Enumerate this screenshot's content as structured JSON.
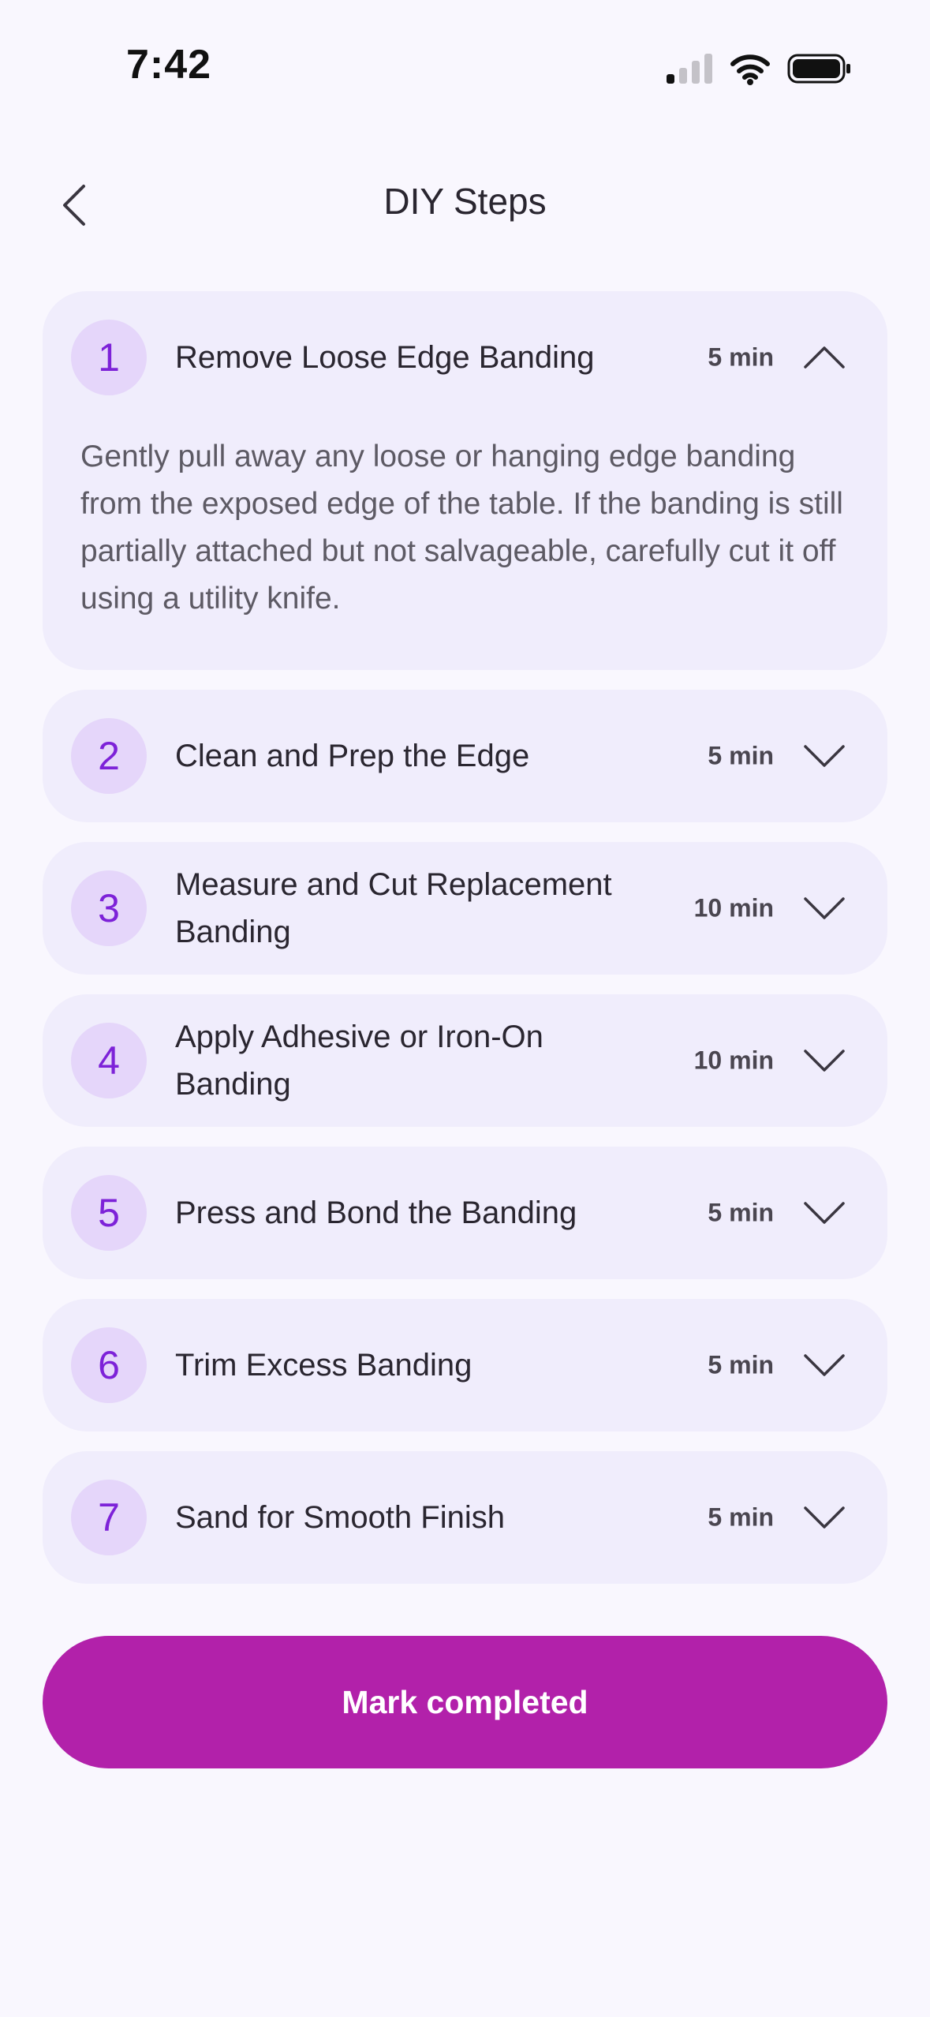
{
  "status_bar": {
    "time": "7:42"
  },
  "header": {
    "back_icon": "chevron-left-icon",
    "title": "DIY Steps"
  },
  "steps": [
    {
      "number": "1",
      "title": "Remove Loose Edge Banding",
      "duration": "5 min",
      "expanded": true,
      "description": "Gently pull away any loose or hanging edge banding from the exposed edge of the table. If the banding is still partially attached but not salvageable, carefully cut it off using a utility knife."
    },
    {
      "number": "2",
      "title": "Clean and Prep the Edge",
      "duration": "5 min",
      "expanded": false
    },
    {
      "number": "3",
      "title": "Measure and Cut Replacement Banding",
      "duration": "10 min",
      "expanded": false
    },
    {
      "number": "4",
      "title": "Apply Adhesive or Iron-On Banding",
      "duration": "10 min",
      "expanded": false
    },
    {
      "number": "5",
      "title": "Press and Bond the Banding",
      "duration": "5 min",
      "expanded": false
    },
    {
      "number": "6",
      "title": "Trim Excess Banding",
      "duration": "5 min",
      "expanded": false
    },
    {
      "number": "7",
      "title": "Sand for Smooth Finish",
      "duration": "5 min",
      "expanded": false
    }
  ],
  "actions": {
    "mark_completed_label": "Mark completed"
  },
  "colors": {
    "background": "#f9f7fe",
    "card": "#f0edfc",
    "number_badge": "#e5d6fa",
    "number_text": "#7d22d8",
    "primary_button": "#b221aa"
  }
}
